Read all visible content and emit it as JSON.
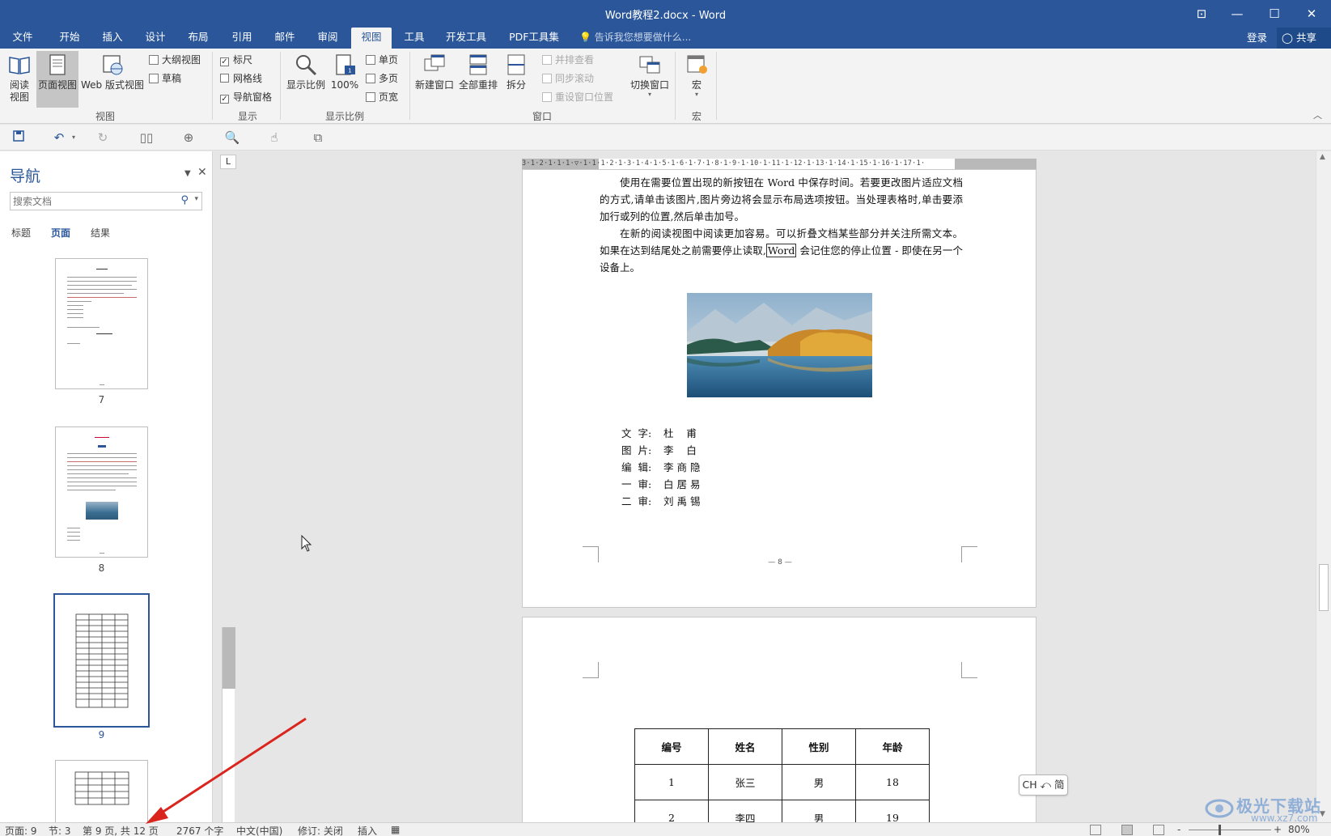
{
  "window": {
    "title": "Word教程2.docx - Word",
    "controls": [
      "⊡",
      "—",
      "☐",
      "✕"
    ]
  },
  "tabs": [
    "文件",
    "开始",
    "插入",
    "设计",
    "布局",
    "引用",
    "邮件",
    "审阅",
    "视图",
    "工具",
    "开发工具",
    "PDF工具集"
  ],
  "active_tab": "视图",
  "tell_me": "告诉我您想要做什么...",
  "login": "登录",
  "share": "共享",
  "ribbon": {
    "views": {
      "read_mode": "阅读\n视图",
      "print_layout": "页面视图",
      "web_layout": "Web 版式视图",
      "outline": "大纲视图",
      "draft": "草稿",
      "group": "视图"
    },
    "show": {
      "ruler": "标尺",
      "gridlines": "网格线",
      "nav_pane": "导航窗格",
      "ruler_checked": true,
      "gridlines_checked": false,
      "nav_pane_checked": true,
      "group": "显示"
    },
    "zoom": {
      "zoom": "显示比例",
      "hundred": "100%",
      "one_page": "单页",
      "multi_page": "多页",
      "page_width": "页宽",
      "group": "显示比例"
    },
    "window": {
      "new_window": "新建窗口",
      "arrange_all": "全部重排",
      "split": "拆分",
      "side_by_side": "并排查看",
      "sync_scroll": "同步滚动",
      "reset_position": "重设窗口位置",
      "switch_windows": "切换窗口",
      "group": "窗口"
    },
    "macros": {
      "macros": "宏",
      "group": "宏"
    }
  },
  "nav": {
    "title": "导航",
    "search_placeholder": "搜索文档",
    "tabs": [
      "标题",
      "页面",
      "结果"
    ],
    "active_tab": "页面",
    "pages": [
      "7",
      "8",
      "9"
    ],
    "selected_page": "9"
  },
  "doc": {
    "page8": {
      "para1": "使用在需要位置出现的新按钮在 Word 中保存时间。若要更改图片适应文档的方式,请单击该图片,图片旁边将会显示布局选项按钮。当处理表格时,单击要添加行或列的位置,然后单击加号。",
      "para2_before": "在新的阅读视图中阅读更加容易。可以折叠文档某些部分并关注所需文本。如果在达到结尾处之前需要停止读取,",
      "para2_word": "Word",
      "para2_after": " 会记住您的停止位置 - 即使在另一个设备上。",
      "credits": [
        {
          "k": "文  字:",
          "v": "杜    甫"
        },
        {
          "k": "图  片:",
          "v": "李    白"
        },
        {
          "k": "编  辑:",
          "v": "李 商 隐"
        },
        {
          "k": "一  审:",
          "v": "白 居 易"
        },
        {
          "k": "二  审:",
          "v": "刘 禹 锡"
        }
      ],
      "page_number": "— 8 —"
    },
    "table": {
      "headers": [
        "编号",
        "姓名",
        "性别",
        "年龄"
      ],
      "rows": [
        [
          "1",
          "张三",
          "男",
          "18"
        ],
        [
          "2",
          "李四",
          "男",
          "19"
        ]
      ]
    }
  },
  "ime": "CH ⤺ 简",
  "status": {
    "page": "页面: 9",
    "section": "节: 3",
    "page_of": "第 9 页, 共 12 页",
    "words": "2767 个字",
    "language": "中文(中国)",
    "track": "修订: 关闭",
    "mode": "插入",
    "zoom": "80%",
    "zoom_minus": "-",
    "zoom_plus": "+"
  },
  "watermark": {
    "line1": "极光下载站",
    "line2": "www.xz7.com"
  },
  "colors": {
    "accent": "#2b579a",
    "arrow": "#d9251d"
  }
}
